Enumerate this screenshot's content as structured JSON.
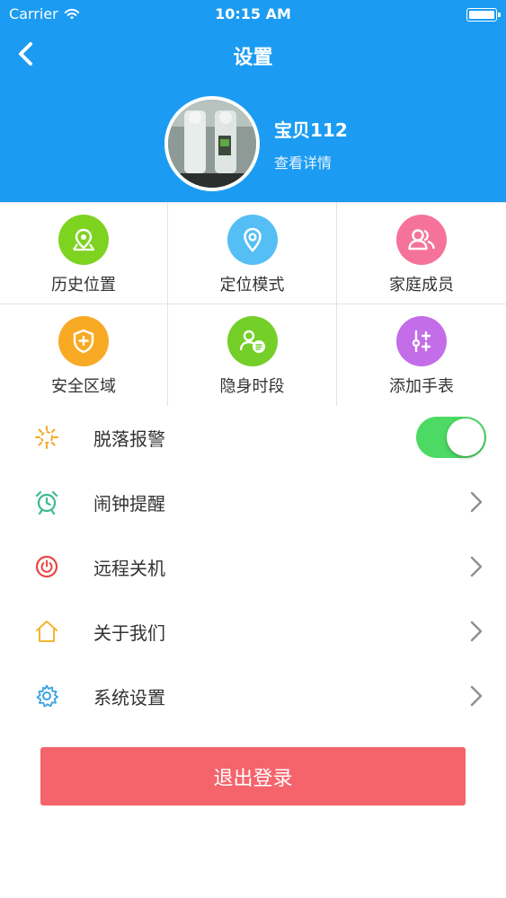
{
  "status_bar": {
    "carrier": "Carrier",
    "time": "10:15 AM"
  },
  "nav": {
    "title": "设置"
  },
  "profile": {
    "name": "宝贝112",
    "subtitle": "查看详情"
  },
  "grid": {
    "items": [
      {
        "label": "历史位置",
        "icon": "map-pin-history-icon",
        "color": "#7ed321"
      },
      {
        "label": "定位模式",
        "icon": "location-pin-icon",
        "color": "#55bef5"
      },
      {
        "label": "家庭成员",
        "icon": "users-icon",
        "color": "#f5739a"
      },
      {
        "label": "安全区域",
        "icon": "shield-plus-icon",
        "color": "#f8aa25"
      },
      {
        "label": "隐身时段",
        "icon": "user-schedule-icon",
        "color": "#74cf28"
      },
      {
        "label": "添加手表",
        "icon": "add-watch-icon",
        "color": "#c36de8"
      }
    ]
  },
  "list": {
    "items": [
      {
        "label": "脱落报警",
        "icon": "fall-alarm-icon",
        "type": "toggle",
        "toggle_on": true
      },
      {
        "label": "闹钟提醒",
        "icon": "alarm-clock-icon",
        "type": "chevron"
      },
      {
        "label": "远程关机",
        "icon": "power-icon",
        "type": "chevron"
      },
      {
        "label": "关于我们",
        "icon": "home-icon",
        "type": "chevron"
      },
      {
        "label": "系统设置",
        "icon": "gear-icon",
        "type": "chevron"
      }
    ]
  },
  "logout": {
    "label": "退出登录"
  },
  "colors": {
    "header": "#1b9cf2",
    "toggle_on": "#4cd964",
    "logout": "#f5636b"
  }
}
